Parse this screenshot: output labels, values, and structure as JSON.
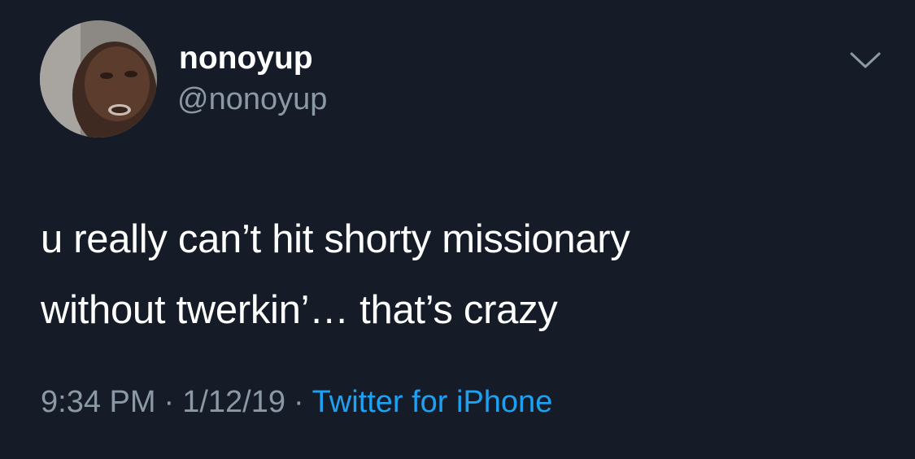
{
  "tweet": {
    "author": {
      "display_name": "nonoyup",
      "handle": "@nonoyup",
      "avatar_icon": "profile-photo"
    },
    "text_lines": [
      "u really can’t hit shorty missionary",
      "without twerkin’… that’s crazy"
    ],
    "time": "9:34 PM",
    "date": "1/12/19",
    "separator": "·",
    "source": "Twitter for iPhone",
    "menu_icon": "chevron-down-icon"
  },
  "colors": {
    "background": "#151c27",
    "text": "#ffffff",
    "secondary_text": "#8b98a5",
    "link": "#1da1f2"
  }
}
